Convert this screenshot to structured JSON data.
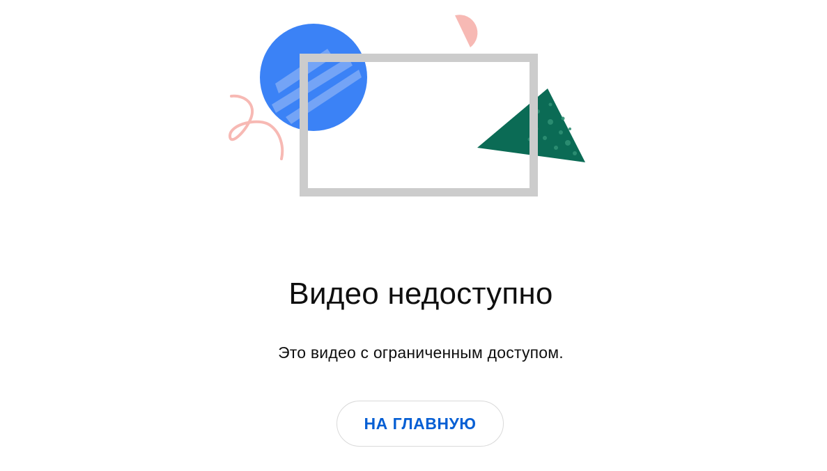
{
  "error": {
    "title": "Видео недоступно",
    "message": "Это видео с ограниченным доступом.",
    "home_button_label": "НА ГЛАВНУЮ"
  },
  "colors": {
    "accent": "#065fd4",
    "blue_circle": "#3b82f6",
    "green_triangle": "#0b6b55",
    "pink_shapes": "#f7b9b4",
    "frame_gray": "#cccccc",
    "text": "#0f0f0f"
  },
  "illustration": {
    "icons": [
      "blue-circle-icon",
      "pink-squiggle-icon",
      "pink-semicircle-icon",
      "gray-frame-icon",
      "green-triangle-icon"
    ]
  }
}
